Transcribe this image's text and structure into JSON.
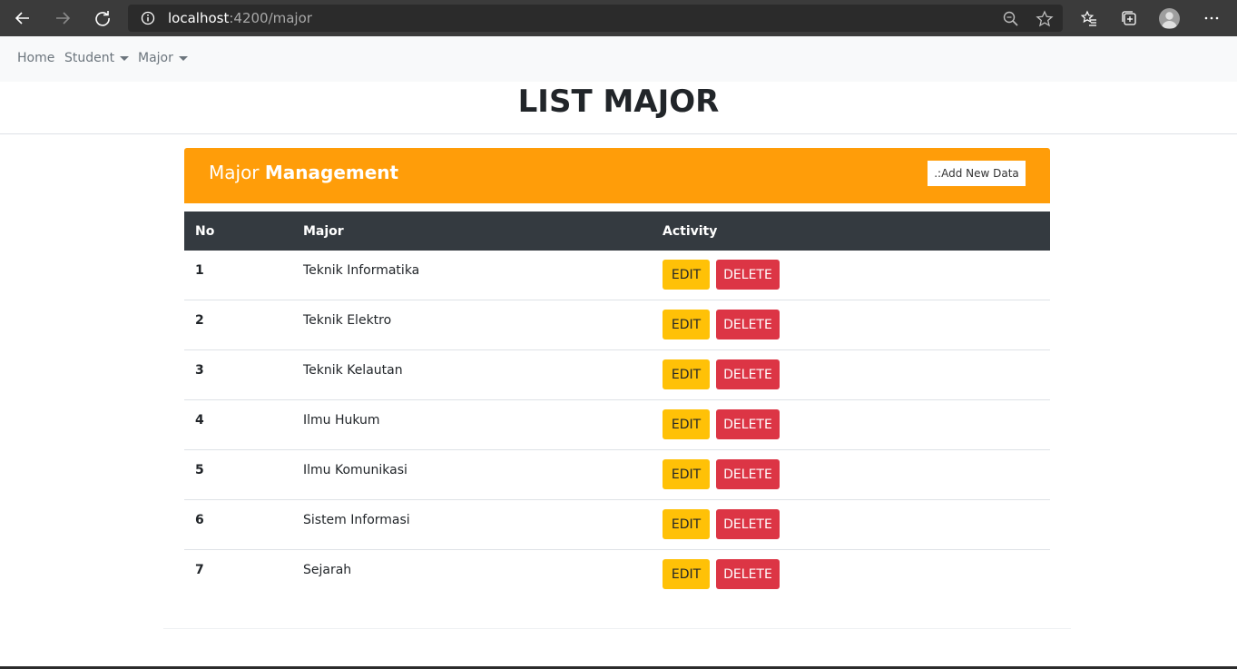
{
  "browser": {
    "url_host": "localhost",
    "url_path": ":4200/major"
  },
  "nav": {
    "home": "Home",
    "student": "Student",
    "major": "Major"
  },
  "page": {
    "title": "LIST MAJOR"
  },
  "card": {
    "title_regular": "Major",
    "title_bold": "Management",
    "add_button": ".:Add New Data"
  },
  "table": {
    "headers": [
      "No",
      "Major",
      "Activity"
    ],
    "rows": [
      {
        "no": "1",
        "major": "Teknik Informatika"
      },
      {
        "no": "2",
        "major": "Teknik Elektro"
      },
      {
        "no": "3",
        "major": "Teknik Kelautan"
      },
      {
        "no": "4",
        "major": "Ilmu Hukum"
      },
      {
        "no": "5",
        "major": "Ilmu Komunikasi"
      },
      {
        "no": "6",
        "major": "Sistem Informasi"
      },
      {
        "no": "7",
        "major": "Sejarah"
      }
    ],
    "edit_label": "EDIT",
    "delete_label": "DELETE"
  },
  "colors": {
    "header_accent": "#ff9d09",
    "table_head": "#343a40",
    "edit": "#ffc107",
    "delete": "#dc3545"
  },
  "icons": [
    "back-icon",
    "forward-icon",
    "refresh-icon",
    "info-icon",
    "zoom-icon",
    "star-icon",
    "favorites-icon",
    "collections-icon",
    "profile-icon",
    "more-icon"
  ]
}
